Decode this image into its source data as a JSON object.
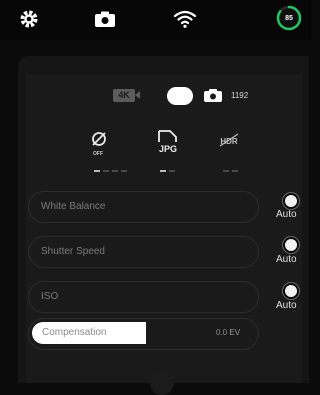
{
  "topbar": {
    "icons": [
      "settings-gear-icon",
      "camera-icon",
      "wifi-icon",
      "battery-ring-icon"
    ],
    "battery_level": "85",
    "battery_fraction": 0.85,
    "battery_color": "#22c55e"
  },
  "mode_row": {
    "video_badge": "4K",
    "photo_count": "1192"
  },
  "options": {
    "timer_sub": "OFF",
    "format_label": "JPG",
    "hdr_label": "HDR"
  },
  "settings": [
    {
      "label": "White Balance",
      "auto": "Auto"
    },
    {
      "label": "Shutter Speed",
      "auto": "Auto"
    },
    {
      "label": "ISO",
      "auto": "Auto"
    }
  ],
  "compensation": {
    "label": "Compensation",
    "value": "0.0",
    "unit": "EV"
  }
}
